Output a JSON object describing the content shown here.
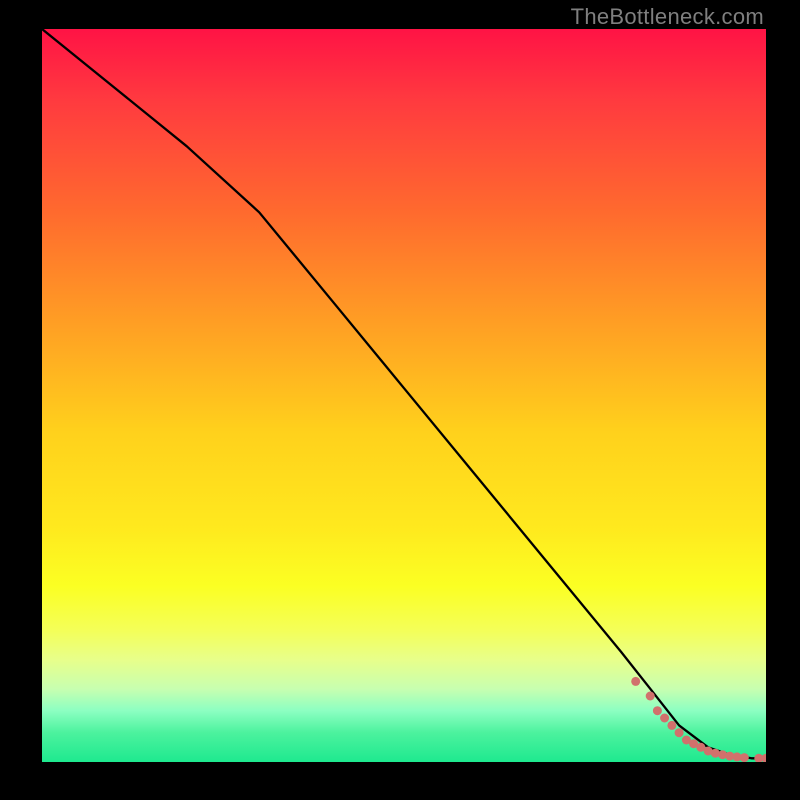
{
  "attribution": "TheBottleneck.com",
  "colors": {
    "gradient_top": "#ff1345",
    "gradient_mid": "#ffe91e",
    "gradient_bottom": "#1ee98f",
    "line": "#000000",
    "dots": "#d1706c",
    "frame": "#000000"
  },
  "chart_data": {
    "type": "line",
    "title": "",
    "xlabel": "",
    "ylabel": "",
    "xlim": [
      0,
      100
    ],
    "ylim": [
      0,
      100
    ],
    "series": [
      {
        "name": "curve",
        "x": [
          0,
          10,
          20,
          30,
          40,
          50,
          60,
          70,
          80,
          84,
          88,
          92,
          95,
          98,
          100
        ],
        "y": [
          100,
          92,
          84,
          75,
          63,
          51,
          39,
          27,
          15,
          10,
          5,
          2,
          1,
          0.5,
          0.5
        ]
      }
    ],
    "scatter": {
      "name": "dots",
      "x": [
        82,
        84,
        85,
        86,
        87,
        88,
        89,
        90,
        91,
        92,
        93,
        94,
        95,
        96,
        97,
        99,
        100
      ],
      "y": [
        11,
        9,
        7,
        6,
        5,
        4,
        3,
        2.5,
        2,
        1.5,
        1.2,
        1,
        0.8,
        0.7,
        0.6,
        0.5,
        0.5
      ],
      "r": 4.5
    }
  }
}
